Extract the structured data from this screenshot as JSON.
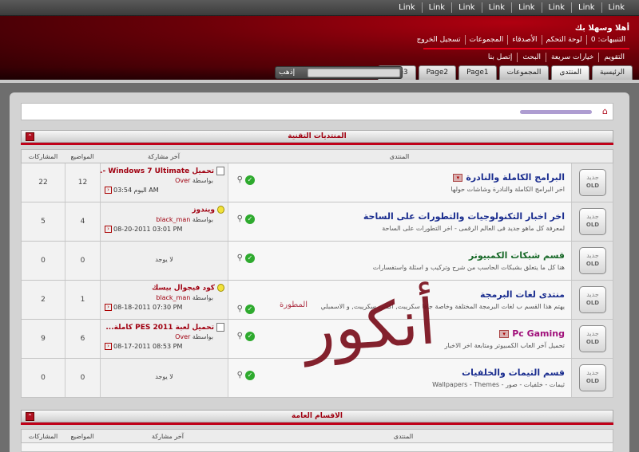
{
  "top_links": [
    "Link",
    "Link",
    "Link",
    "Link",
    "Link",
    "Link",
    "Link",
    "Link"
  ],
  "header": {
    "welcome": "أهلا وسهلا بك",
    "user_links": [
      "التنبيهات: 0",
      "لوحة التحكم",
      "الأصدقاء",
      "المجموعات",
      "تسجيل الخروج"
    ],
    "nav_links": [
      "التقويم",
      "خيارات سريعة",
      "البحث",
      "إتصل بنا"
    ]
  },
  "tabs": [
    "الرئيسية",
    "المنتدى",
    "المجموعات",
    "Page1",
    "Page2",
    "Page3"
  ],
  "search": {
    "button": "إذهب",
    "placeholder": ""
  },
  "sections": [
    {
      "title": "المنتديات التقنية",
      "columns": {
        "forum": "المنتدى",
        "last_post": "آخر مشاركة",
        "topics": "المواضيع",
        "posts": "المشاركات"
      },
      "forums": [
        {
          "title": "البرامج الكاملة والنادرة",
          "desc": "اخر البرامج الكاملة والنادرة وشاشات حولها",
          "last_title": "تحميل Windows 7 Ultimate -...",
          "last_icon": "post",
          "last_by_label": "بواسطة",
          "last_by": "Over",
          "last_date": "اليوم 03:54 AM",
          "topics": "12",
          "posts": "22",
          "has_dropdown": true
        },
        {
          "title": "اخر اخبار التكنولوجيات والتطورات على الساحة",
          "desc": "لمعرفة كل ماهو جديد فى العالم الرقمى - اخر التطورات على الساحة",
          "last_title": "ويندوز",
          "last_icon": "bulb",
          "last_by_label": "بواسطة",
          "last_by": "black_man",
          "last_date": "08-20-2011 03:01 PM",
          "topics": "4",
          "posts": "5",
          "has_dropdown": false
        },
        {
          "title": "قسم شبكات الكمبيوتر",
          "desc": "هنا كل ما يتعلق بشبكات الحاسب من شرح وتركيب و اسئلة واستفسارات",
          "last_title": "",
          "last_none": "لا يوجد",
          "topics": "0",
          "posts": "0",
          "has_dropdown": false
        },
        {
          "title": "منتدى لغات البرمجة",
          "desc": "يهتم هذا القسم ب لغات البرمجة المختلفة وخاصة جافا سكريبت, أكشن سكريبت, و الاسمبلي",
          "last_title": "كود فيجوال بيسك",
          "last_icon": "bulb",
          "last_by_label": "بواسطة",
          "last_by": "black_man",
          "last_date": "08-18-2011 07:30 PM",
          "topics": "1",
          "posts": "2",
          "has_dropdown": false
        },
        {
          "title": "Pc Gaming",
          "desc": "تحميل آخر العاب الكمبيوتر ومتابعة اخر الاخبار",
          "last_title": "تحميل لعبة PES 2011 كاملة...",
          "last_icon": "post",
          "last_by_label": "بواسطة",
          "last_by": "Over",
          "last_date": "08-17-2011 08:53 PM",
          "topics": "6",
          "posts": "9",
          "has_dropdown": true
        },
        {
          "title": "قسم الثيمات والخلفيات",
          "desc": "ثيمات - خلفيات - صور - Wallpapers - Themes",
          "last_title": "",
          "last_none": "لا يوجد",
          "topics": "0",
          "posts": "0",
          "has_dropdown": false
        }
      ]
    },
    {
      "title": "الاقسام العامة",
      "columns": {
        "forum": "المنتدى",
        "last_post": "آخر مشاركة",
        "topics": "المواضيع",
        "posts": "المشاركات"
      }
    }
  ],
  "badge": {
    "top": "جديد",
    "bottom": "OLD"
  },
  "watermark": {
    "main": "أنكور",
    "sub": "المطورة"
  },
  "colors": {
    "accent": "#a00010",
    "forum_title": "#1a2d8f",
    "header_red": "#6a0008"
  }
}
